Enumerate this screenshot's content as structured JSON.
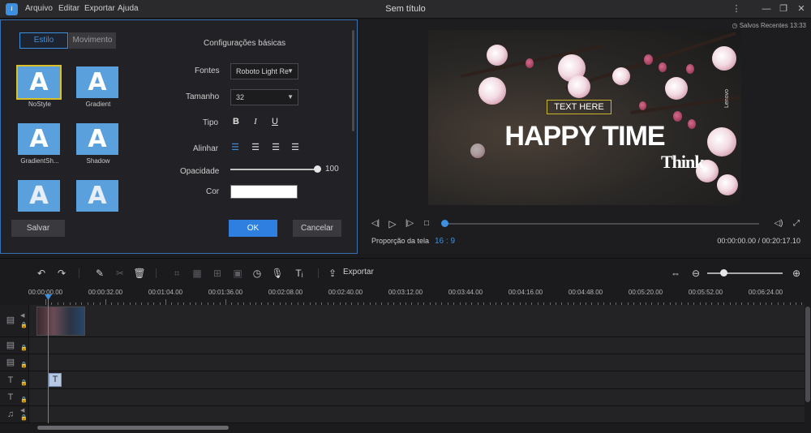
{
  "titlebar": {
    "logo_glyph": "ʲ",
    "menu": [
      "Arquivo",
      "Editar",
      "Exportar",
      "Ajuda"
    ],
    "title": "Sem título",
    "controls": [
      "ellipsis-icon",
      "minimize-icon",
      "restore-icon",
      "close-icon"
    ]
  },
  "left_panel": {
    "tabs": [
      "Estilo",
      "Movimento"
    ],
    "active_tab": "Estilo",
    "styles": [
      {
        "label": "NoStyle",
        "glyph": "A",
        "selected": true
      },
      {
        "label": "Gradient",
        "glyph": "A",
        "selected": false
      },
      {
        "label": "GradientSh...",
        "glyph": "A",
        "selected": false
      },
      {
        "label": "Shadow",
        "glyph": "A",
        "selected": false
      },
      {
        "label": "",
        "glyph": "A",
        "selected": false
      },
      {
        "label": "",
        "glyph": "A",
        "selected": false
      }
    ],
    "basic_title": "Configurações básicas",
    "fontes_label": "Fontes",
    "font_value": "Roboto Light Re",
    "tamanho_label": "Tamanho",
    "size_value": "32",
    "tipo_label": "Tipo",
    "tipo_buttons": [
      "B",
      "I",
      "U"
    ],
    "alinhar_label": "Alinhar",
    "opacidade_label": "Opacidade",
    "opacity_value": "100",
    "opacity_fraction": 1.0,
    "cor_label": "Cor",
    "color_value": "#ffffff",
    "salvar": "Salvar",
    "ok": "OK",
    "cancelar": "Cancelar"
  },
  "preview": {
    "saved_label": "Salvos Recentes 13:33",
    "overlay_text": "TEXT HERE",
    "headline": "HAPPY TIME",
    "think": "Think",
    "lenovo": "Lenovo",
    "ratio_label": "Proporção da tela",
    "ratio_value": "16 : 9",
    "time": "00:00:00.00 / 00:20:17.10",
    "progress_fraction": 0.0
  },
  "toolbar": {
    "export_label": "Exportar"
  },
  "ruler": {
    "labels": [
      "00:00:00.00",
      "00:00:32.00",
      "00:01:04.00",
      "00:01:36.00",
      "00:02:08.00",
      "00:02:40.00",
      "00:03:12.00",
      "00:03:44.00",
      "00:04:16.00",
      "00:04:48.00",
      "00:05:20.00",
      "00:05:52.00",
      "00:06:24.00"
    ]
  },
  "tracks": {
    "text_clip_glyph": "T"
  },
  "colors": {
    "accent": "#3d8fe0",
    "selection": "#d9c02a",
    "panel": "#222226"
  }
}
